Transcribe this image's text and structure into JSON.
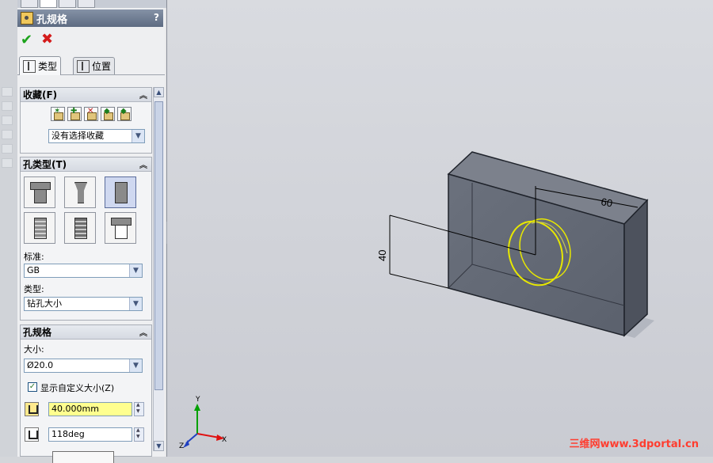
{
  "panel": {
    "title": "孔规格",
    "help": "?",
    "ok": "✔",
    "cancel": "✖",
    "tabs": [
      {
        "label": "类型"
      },
      {
        "label": "位置"
      }
    ]
  },
  "favorites": {
    "title": "收藏(F)",
    "select": "没有选择收藏"
  },
  "hole_type": {
    "title": "孔类型(T)",
    "standard_label": "标准:",
    "standard_value": "GB",
    "type_label": "类型:",
    "type_value": "钻孔大小"
  },
  "hole_spec": {
    "title": "孔规格",
    "size_label": "大小:",
    "size_value": "Ø20.0",
    "custom_size_label": "显示自定义大小(Z)",
    "custom_size_checked": true,
    "depth_value": "40.000mm",
    "angle_value": "118deg"
  },
  "viewport": {
    "dim_h": "60",
    "dim_v": "40",
    "axis_x": "X",
    "axis_y": "Y",
    "axis_z": "Z",
    "watermark": "三维网www.3dportal.cn"
  },
  "colors": {
    "accent": "#5d6b82",
    "highlight": "#ffff8f",
    "selection_edge": "#e8e800"
  }
}
